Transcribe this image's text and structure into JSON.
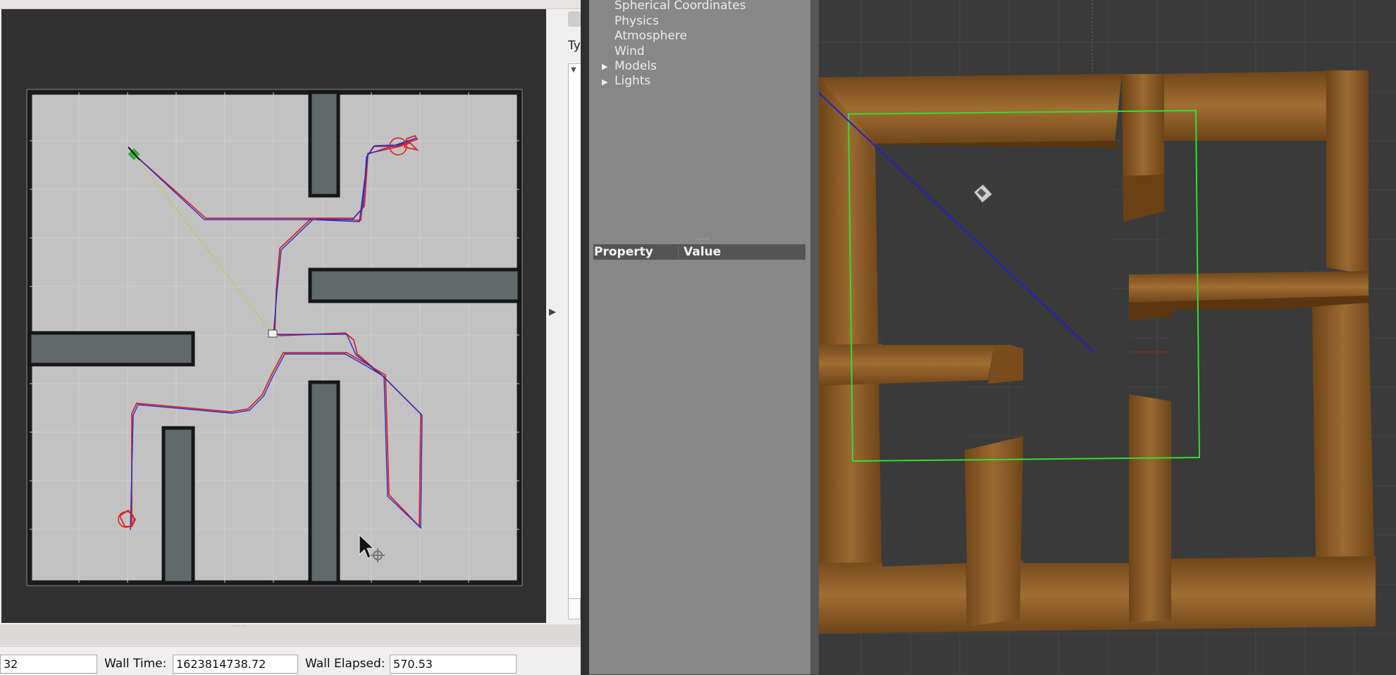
{
  "rviz": {
    "panel_type_label": "Ty",
    "status_bar": {
      "left_value": "32",
      "wall_time_label": "Wall Time:",
      "wall_time_value": "1623814738.72",
      "wall_elapsed_label": "Wall Elapsed:",
      "wall_elapsed_value": "570.53"
    },
    "path_colors": {
      "planned_path": "#e02020",
      "actual_path": "#2030d0",
      "goal_line": "#c8c820"
    }
  },
  "gazebo": {
    "world_tree": [
      {
        "label": "Spherical Coordinates",
        "expandable": false
      },
      {
        "label": "Physics",
        "expandable": false
      },
      {
        "label": "Atmosphere",
        "expandable": false
      },
      {
        "label": "Wind",
        "expandable": false
      },
      {
        "label": "Models",
        "expandable": true
      },
      {
        "label": "Lights",
        "expandable": true
      }
    ],
    "property_table": {
      "col_property": "Property",
      "col_value": "Value"
    },
    "colors": {
      "panel_bg": "#878787",
      "wood": "#8a5a25",
      "bbox": "#33dd33"
    }
  },
  "icons": [
    "expand-right-arrow-icon",
    "tree-expand-icon",
    "mouse-cursor-icon",
    "move-cursor-icon",
    "robot-marker-icon"
  ]
}
